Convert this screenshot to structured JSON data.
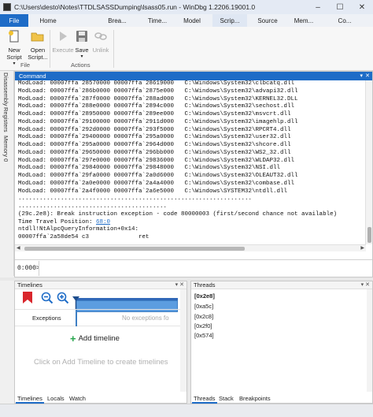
{
  "window": {
    "title": "C:\\Users\\desto\\Notes\\TTDLSASSDumping\\lsass05.run - WinDbg 1.2206.19001.0"
  },
  "ribbon": {
    "tabs": [
      "File",
      "Home",
      "Brea...",
      "Time...",
      "Model",
      "Scrip...",
      "Source",
      "Mem...",
      "Co..."
    ],
    "active_tab": "Scrip...",
    "file_group": {
      "label": "File",
      "new_script_label": "New Script",
      "open_script_label": "Open Script..."
    },
    "actions_group": {
      "label": "Actions",
      "execute_label": "Execute",
      "save_label": "Save",
      "unlink_label": "Unlink"
    }
  },
  "side_tabs": [
    "Disassembly",
    "Registers",
    "Memory 0"
  ],
  "command_window": {
    "tab_label": "Command",
    "output_lines": [
      "ModLoad: 00007ffa`28570000 00007ffa`28619000   C:\\Windows\\System32\\clbcatq.dll",
      "ModLoad: 00007ffa`286b0000 00007ffa`2875e000   C:\\Windows\\System32\\advapi32.dll",
      "ModLoad: 00007ffa`287f0000 00007ffa`288ad000   C:\\Windows\\System32\\KERNEL32.DLL",
      "ModLoad: 00007ffa`288e0000 00007ffa`2894c000   C:\\Windows\\System32\\sechost.dll",
      "ModLoad: 00007ffa`28950000 00007ffa`289ee000   C:\\Windows\\System32\\msvcrt.dll",
      "ModLoad: 00007ffa`29100000 00007ffa`2911d000   C:\\Windows\\System32\\imagehlp.dll",
      "ModLoad: 00007ffa`292d0000 00007ffa`293f5000   C:\\Windows\\System32\\RPCRT4.dll",
      "ModLoad: 00007ffa`29400000 00007ffa`295a0000   C:\\Windows\\System32\\user32.dll",
      "ModLoad: 00007ffa`295a0000 00007ffa`2964d000   C:\\Windows\\System32\\shcore.dll",
      "ModLoad: 00007ffa`29650000 00007ffa`296bb000   C:\\Windows\\System32\\WS2_32.dll",
      "ModLoad: 00007ffa`297e0000 00007ffa`29836000   C:\\Windows\\System32\\WLDAP32.dll",
      "ModLoad: 00007ffa`29840000 00007ffa`29848000   C:\\Windows\\System32\\NSI.dll",
      "ModLoad: 00007ffa`29fa0000 00007ffa`2a0d6000   C:\\Windows\\System32\\OLEAUT32.dll",
      "ModLoad: 00007ffa`2a0e0000 00007ffa`2a4a4000   C:\\Windows\\System32\\combase.dll",
      "ModLoad: 00007ffa`2a4f0000 00007ffa`2a6e5000   C:\\Windows\\SYSTEM32\\ntdll.dll",
      "..................................................................",
      "..........................................",
      "(29c.2e8): Break instruction exception - code 80000003 (first/second chance not available)",
      "Time Travel Position: 68:0",
      "ntdll!NtAlpcQueryInformation+0x14:",
      "00007ffa`2a58de54 c3              ret"
    ],
    "prompt": "0:000>",
    "input_value": ""
  },
  "timelines": {
    "title": "Timelines",
    "exceptions_label": "Exceptions",
    "exceptions_empty": "No exceptions fo",
    "add_label": "Add timeline",
    "hint": "Click on Add Timeline to create timelines",
    "bottom_tabs": [
      "Timelines",
      "Locals",
      "Watch"
    ]
  },
  "threads": {
    "title": "Threads",
    "items": [
      "[0x2e8]",
      "[0xa5c]",
      "[0x2c8]",
      "[0x2f0]",
      "[0x574]"
    ],
    "selected": "[0x2e8]",
    "bottom_tabs": [
      "Threads",
      "Stack",
      "Breakpoints"
    ]
  },
  "colors": {
    "accent": "#1e6cc7",
    "timeline_bar": "#5c9de0",
    "add_icon": "#24a44a",
    "breakpoint_marker": "#d9262c"
  },
  "icons": [
    "new-script-icon",
    "open-script-icon",
    "execute-icon",
    "save-icon",
    "unlink-icon",
    "breakpoint-marker-icon",
    "zoom-out-icon",
    "zoom-in-icon",
    "plus-icon"
  ]
}
